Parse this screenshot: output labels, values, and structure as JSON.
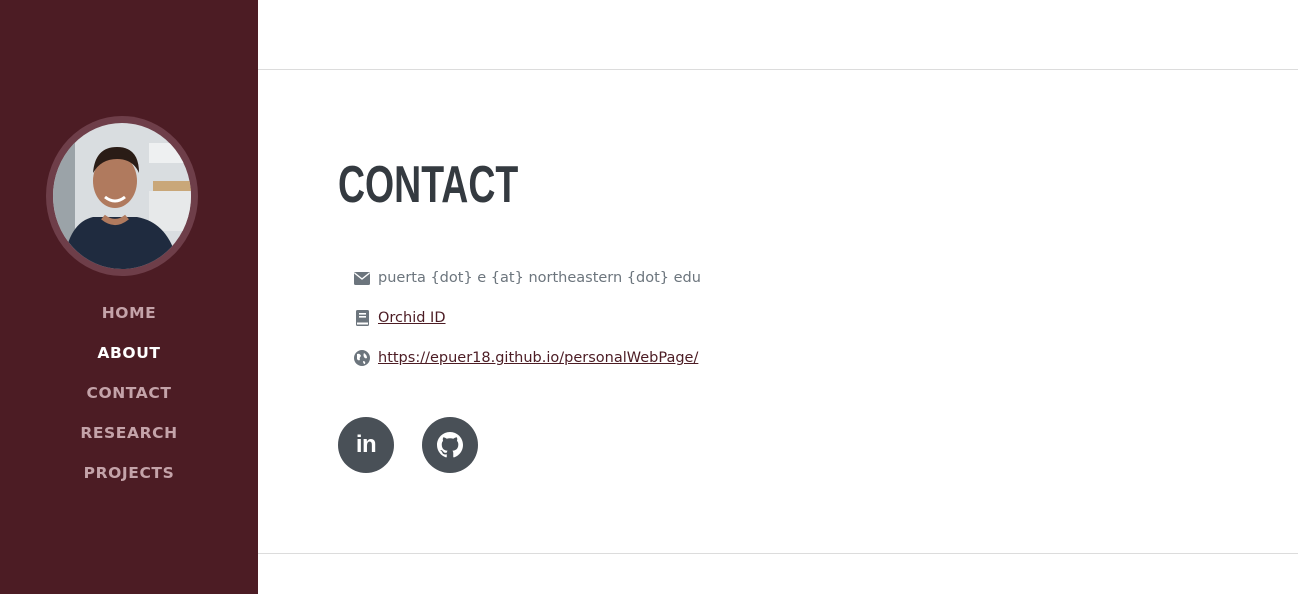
{
  "colors": {
    "sidebar_bg": "#4c1c24",
    "nav_active": "#ffffff",
    "nav_inactive": "#c4a3a9",
    "heading": "#343a40",
    "social_bg": "#495057"
  },
  "sidebar": {
    "avatar_alt": "profile photo",
    "nav": [
      {
        "label": "HOME",
        "active": false
      },
      {
        "label": "ABOUT",
        "active": true
      },
      {
        "label": "CONTACT",
        "active": false
      },
      {
        "label": "RESEARCH",
        "active": false
      },
      {
        "label": "PROJECTS",
        "active": false
      }
    ]
  },
  "main": {
    "title": "CONTACT",
    "contacts": [
      {
        "icon": "envelope-icon",
        "text": "puerta {dot} e {at} northeastern {dot} edu",
        "link": false
      },
      {
        "icon": "book-icon",
        "text": "Orchid ID",
        "link": true
      },
      {
        "icon": "globe-icon",
        "text": "https://epuer18.github.io/personalWebPage/",
        "link": true
      }
    ],
    "social": [
      {
        "icon": "linkedin-icon",
        "glyph": "in"
      },
      {
        "icon": "github-icon"
      }
    ]
  }
}
